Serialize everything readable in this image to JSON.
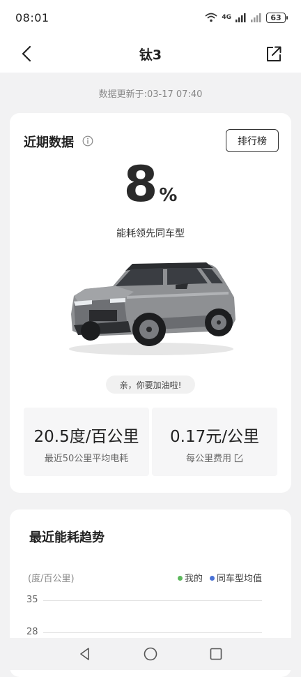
{
  "status": {
    "time": "08:01",
    "battery": "63",
    "network": "4G"
  },
  "nav": {
    "title": "钛3"
  },
  "updated": "数据更新于:03-17 07:40",
  "recent": {
    "title": "近期数据",
    "rank_label": "排行榜",
    "percent": "8",
    "percent_unit": "%",
    "lead_text": "能耗领先同车型",
    "bubble": "亲，你要加油啦!",
    "stats": [
      {
        "value": "20.5度/百公里",
        "label": "最近50公里平均电耗"
      },
      {
        "value": "0.17元/公里",
        "label": "每公里费用"
      }
    ]
  },
  "trend": {
    "title": "最近能耗趋势",
    "unit": "(度/百公里)",
    "legend": [
      {
        "name": "我的",
        "color": "#5cb85c"
      },
      {
        "name": "同车型均值",
        "color": "#4a72d6"
      }
    ],
    "ticks": [
      "35",
      "28"
    ]
  }
}
